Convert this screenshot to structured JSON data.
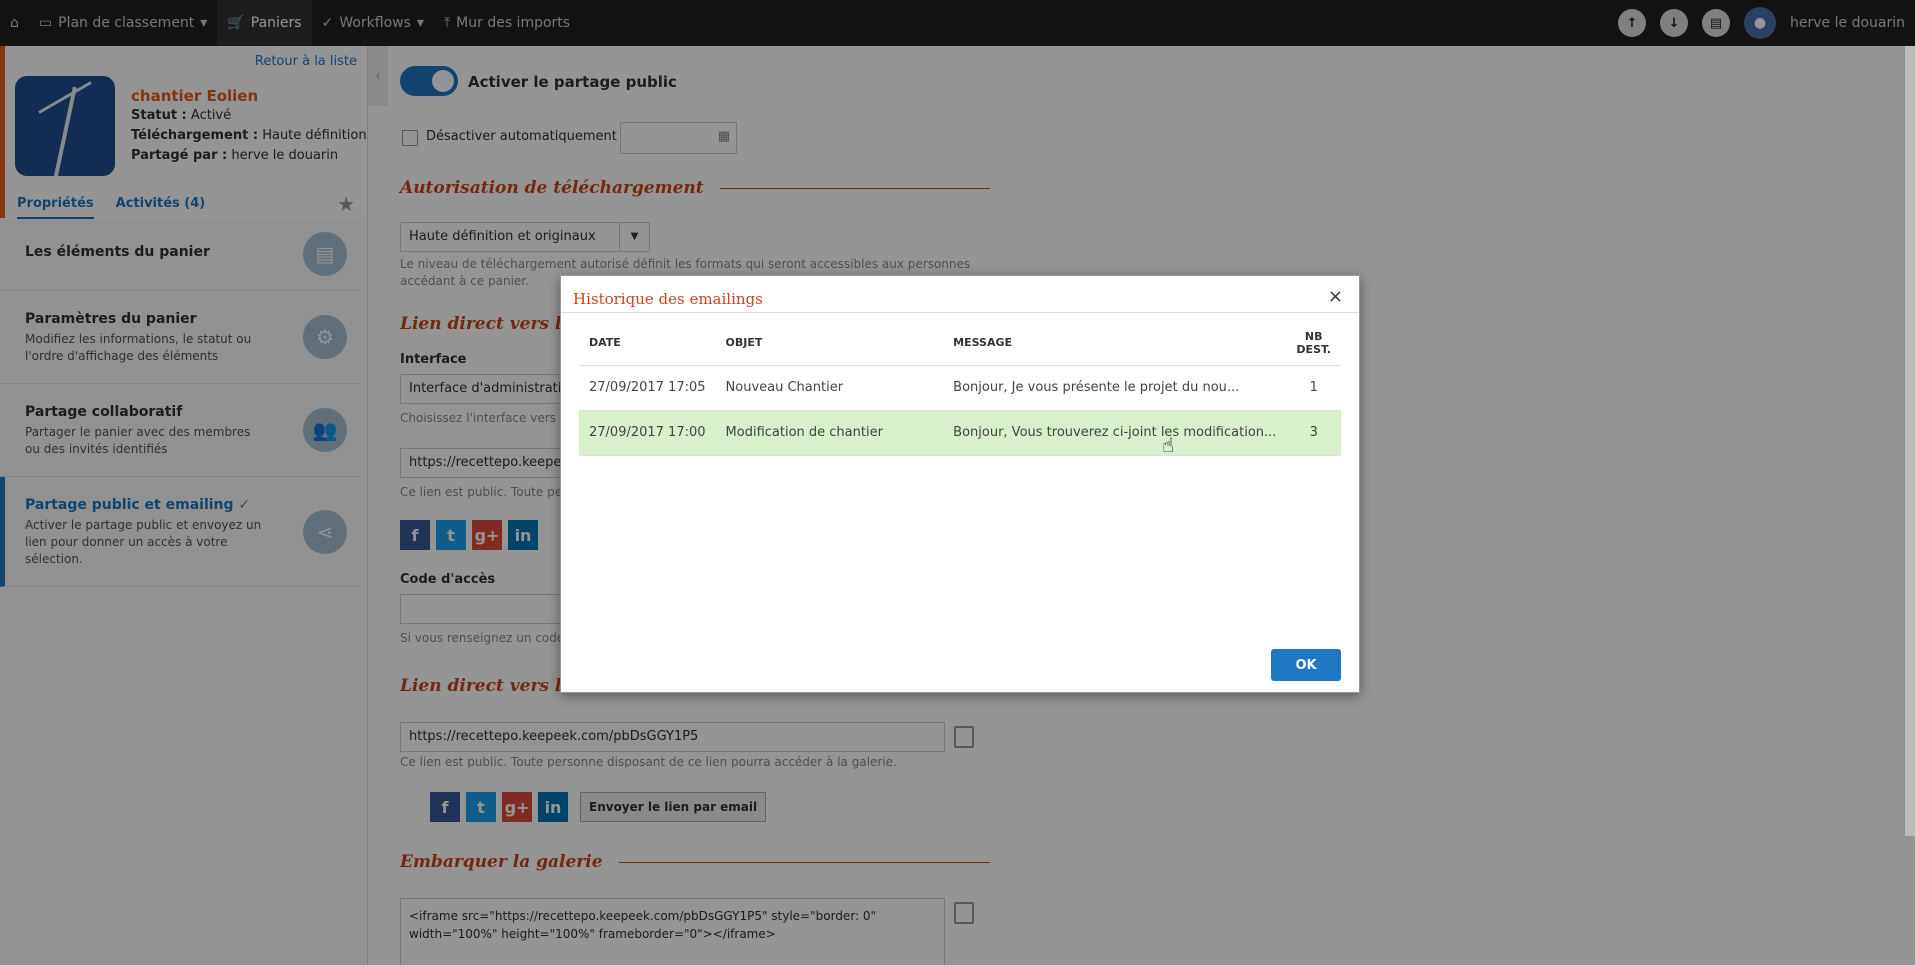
{
  "topbar": {
    "home_icon": "home-icon",
    "items": [
      {
        "label": "Plan de classement",
        "icon": "folder-icon"
      },
      {
        "label": "Paniers",
        "icon": "cart-icon"
      },
      {
        "label": "Workflows",
        "icon": "check-icon"
      },
      {
        "label": "Mur des imports",
        "icon": "upload-icon"
      }
    ],
    "user_name": "herve le douarin"
  },
  "sidebar": {
    "back_link": "Retour à la liste",
    "title": "chantier Eolien",
    "statut_label": "Statut :",
    "statut_value": "Activé",
    "telechargement_label": "Téléchargement :",
    "telechargement_value": "Haute définition",
    "partage_label": "Partagé par :",
    "partage_value": "herve le douarin",
    "tabs": [
      "Propriétés",
      "Activités (4)"
    ],
    "items": [
      {
        "title": "Les éléments du panier",
        "desc": ""
      },
      {
        "title": "Paramètres du panier",
        "desc": "Modifiez les informations, le statut ou l'ordre d'affichage des éléments"
      },
      {
        "title": "Partage collaboratif",
        "desc": "Partager le panier avec des membres ou des invités identifiés"
      },
      {
        "title": "Partage public et emailing",
        "desc": "Activer le partage public et envoyez un lien pour donner un accès à votre sélection."
      }
    ]
  },
  "main": {
    "toggle_label": "Activer le partage public",
    "auto_disable_label": "Désactiver automatiquement le",
    "section_download": "Autorisation de téléchargement",
    "download_select": "Haute définition et originaux",
    "download_help": "Le niveau de téléchargement autorisé définit les formats qui seront accessibles aux personnes accédant à ce panier.",
    "section_direct_link": "Lien direct vers le",
    "interface_label": "Interface",
    "interface_value": "Interface d'administration",
    "interface_help": "Choisissez l'interface vers la",
    "url_1": "https://recettepo.keepeek",
    "public_help_1": "Ce lien est public. Toute pe",
    "access_code_label": "Code d'accès",
    "access_code_help": "Si vous renseignez un code",
    "section_gallery_link": "Lien direct vers la",
    "url_2": "https://recettepo.keepeek.com/pbDsGGY1P5",
    "public_help_2": "Ce lien est public. Toute personne disposant de ce lien pourra accéder à la galerie.",
    "send_email_button": "Envoyer le lien par email",
    "section_embed": "Embarquer la galerie",
    "embed_code": "<iframe src=\"https://recettepo.keepeek.com/pbDsGGY1P5\" style=\"border: 0\" width=\"100%\" height=\"100%\" frameborder=\"0\"></iframe>"
  },
  "modal": {
    "title": "Historique des emailings",
    "close": "×",
    "columns": [
      "DATE",
      "OBJET",
      "MESSAGE",
      "NB DEST."
    ],
    "rows": [
      {
        "date": "27/09/2017 17:05",
        "objet": "Nouveau Chantier",
        "message": "Bonjour, Je vous présente le projet du nou...",
        "nb": "1"
      },
      {
        "date": "27/09/2017 17:00",
        "objet": "Modification de chantier",
        "message": "Bonjour, Vous trouverez ci-joint les modification...",
        "nb": "3"
      }
    ],
    "ok_label": "OK"
  },
  "colors": {
    "accent": "#1f76c2",
    "title_orange": "#c9461b",
    "highlight_row": "#d9f0cc",
    "topbar": "#222222"
  }
}
